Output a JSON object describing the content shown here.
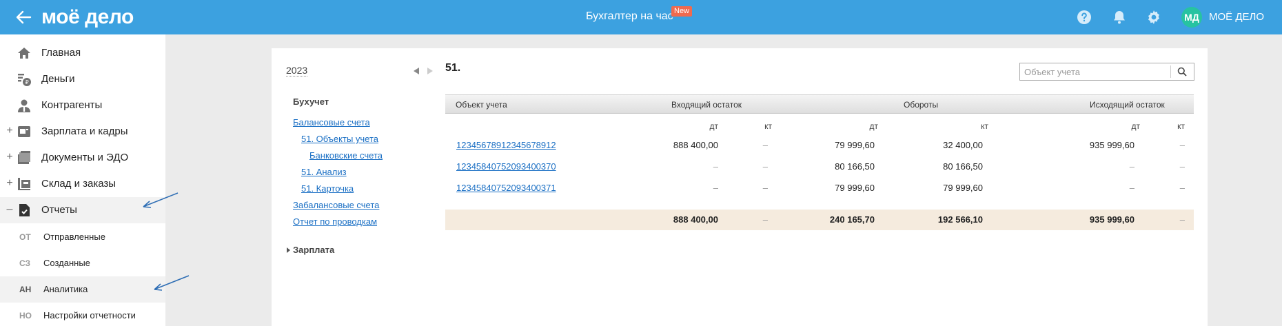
{
  "header": {
    "logo": "моё дело",
    "promo": "Бухгалтер на час",
    "badge": "New",
    "avatar_initials": "МД",
    "username": "МОЁ ДЕЛО",
    "accent_color": "#3ca1e0"
  },
  "sidebar": {
    "items": [
      {
        "label": "Главная",
        "icon": "home-icon",
        "expand": ""
      },
      {
        "label": "Деньги",
        "icon": "money-icon",
        "expand": ""
      },
      {
        "label": "Контрагенты",
        "icon": "contractors-icon",
        "expand": ""
      },
      {
        "label": "Зарплата и кадры",
        "icon": "salary-icon",
        "expand": "+"
      },
      {
        "label": "Документы и ЭДО",
        "icon": "documents-icon",
        "expand": "+"
      },
      {
        "label": "Склад и заказы",
        "icon": "warehouse-icon",
        "expand": "+"
      },
      {
        "label": "Отчеты",
        "icon": "reports-icon",
        "expand": "–"
      }
    ],
    "sub_items": [
      {
        "abbr": "ОТ",
        "label": "Отправленные"
      },
      {
        "abbr": "СЗ",
        "label": "Созданные"
      },
      {
        "abbr": "АН",
        "label": "Аналитика"
      },
      {
        "abbr": "НО",
        "label": "Настройки отчетности"
      }
    ]
  },
  "panel": {
    "year": "2023",
    "tree": {
      "section1": "Бухучет",
      "links": [
        "Балансовые счета",
        "51. Объекты учета",
        "Банковские счета",
        "51. Анализ",
        "51. Карточка",
        "Забалансовые счета",
        "Отчет по проводкам"
      ],
      "section2": "Зарплата"
    },
    "account_title": "51.",
    "search_placeholder": "Объект учета",
    "table": {
      "headers": {
        "object": "Объект учета",
        "opening": "Входящий остаток",
        "turnover": "Обороты",
        "closing": "Исходящий остаток"
      },
      "sub": {
        "dt": "дт",
        "kt": "кт"
      },
      "rows": [
        {
          "object": "12345678912345678912",
          "open_dt": "888 400,00",
          "open_kt": "–",
          "turn_dt": "79 999,60",
          "turn_kt": "32 400,00",
          "close_dt": "935 999,60",
          "close_kt": "–"
        },
        {
          "object": "12345840752093400370",
          "open_dt": "–",
          "open_kt": "–",
          "turn_dt": "80 166,50",
          "turn_kt": "80 166,50",
          "close_dt": "–",
          "close_kt": "–"
        },
        {
          "object": "12345840752093400371",
          "open_dt": "–",
          "open_kt": "–",
          "turn_dt": "79 999,60",
          "turn_kt": "79 999,60",
          "close_dt": "–",
          "close_kt": "–"
        }
      ],
      "total": {
        "open_dt": "888 400,00",
        "open_kt": "–",
        "turn_dt": "240 165,70",
        "turn_kt": "192 566,10",
        "close_dt": "935 999,60",
        "close_kt": "–"
      }
    }
  }
}
